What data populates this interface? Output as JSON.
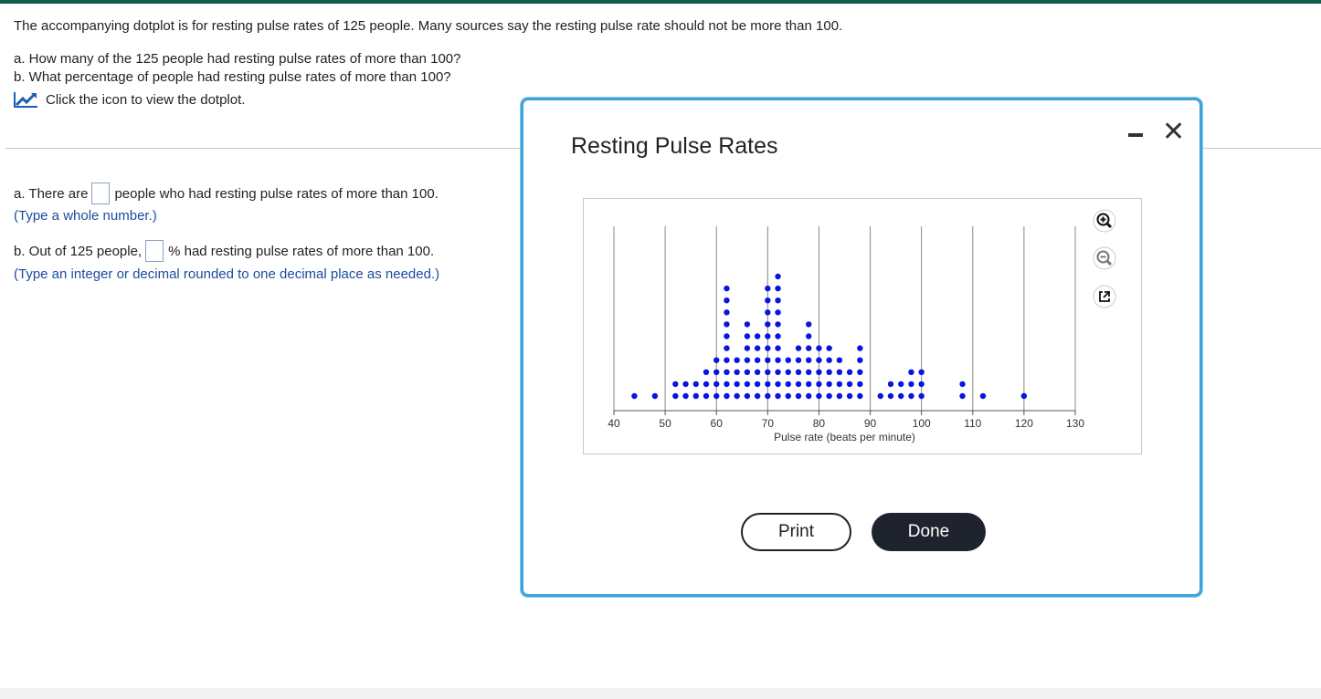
{
  "question": {
    "intro": "The accompanying dotplot is for resting pulse rates of 125 people. Many sources say the resting pulse rate should not be more than 100.",
    "part_a": "a. How many of the 125 people had resting pulse rates of more than 100?",
    "part_b": "b. What percentage of people had resting pulse rates of more than 100?",
    "view_link": "Click the icon to view the dotplot."
  },
  "answers": {
    "a_prefix": "a. There are",
    "a_suffix": "people who had resting pulse rates of more than 100.",
    "a_hint": "(Type a whole number.)",
    "b_prefix": "b. Out of 125 people,",
    "b_suffix": "% had resting pulse rates of more than 100.",
    "b_hint": "(Type an integer or decimal rounded to one decimal place as needed.)"
  },
  "dialog": {
    "title": "Resting Pulse Rates",
    "print_label": "Print",
    "done_label": "Done",
    "dot_color": "#0a14e0"
  },
  "chart_data": {
    "type": "dotplot",
    "xlabel": "Pulse rate (beats per minute)",
    "xlim": [
      40,
      130
    ],
    "xticks": [
      40,
      50,
      60,
      70,
      80,
      90,
      100,
      110,
      120,
      130
    ],
    "grid": true,
    "stacks": [
      {
        "x": 44,
        "count": 1
      },
      {
        "x": 48,
        "count": 1
      },
      {
        "x": 52,
        "count": 2
      },
      {
        "x": 54,
        "count": 2
      },
      {
        "x": 56,
        "count": 2
      },
      {
        "x": 58,
        "count": 3
      },
      {
        "x": 60,
        "count": 4
      },
      {
        "x": 62,
        "count": 10
      },
      {
        "x": 64,
        "count": 4
      },
      {
        "x": 66,
        "count": 7
      },
      {
        "x": 68,
        "count": 6
      },
      {
        "x": 70,
        "count": 10
      },
      {
        "x": 72,
        "count": 11
      },
      {
        "x": 74,
        "count": 4
      },
      {
        "x": 76,
        "count": 5
      },
      {
        "x": 78,
        "count": 7
      },
      {
        "x": 80,
        "count": 5
      },
      {
        "x": 82,
        "count": 5
      },
      {
        "x": 84,
        "count": 4
      },
      {
        "x": 86,
        "count": 3
      },
      {
        "x": 88,
        "count": 5
      },
      {
        "x": 92,
        "count": 1
      },
      {
        "x": 94,
        "count": 2
      },
      {
        "x": 96,
        "count": 2
      },
      {
        "x": 98,
        "count": 3
      },
      {
        "x": 100,
        "count": 3
      },
      {
        "x": 108,
        "count": 2
      },
      {
        "x": 112,
        "count": 1
      },
      {
        "x": 120,
        "count": 1
      }
    ]
  }
}
